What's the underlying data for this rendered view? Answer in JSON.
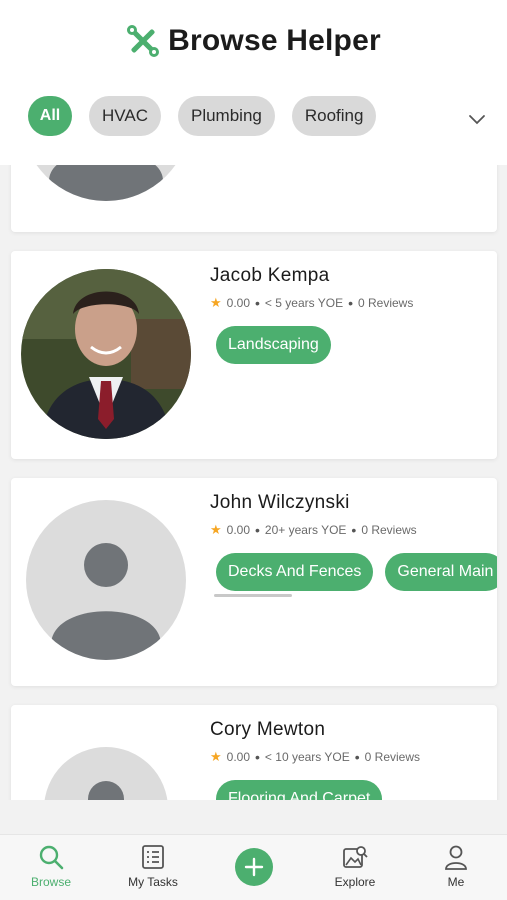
{
  "app": {
    "title": "Browse Helper",
    "logo_icon": "wrench-screwdriver-icon",
    "accent": "#4caf6f"
  },
  "filters": {
    "chips": [
      {
        "label": "All",
        "active": true
      },
      {
        "label": "HVAC"
      },
      {
        "label": "Plumbing"
      },
      {
        "label": "Roofing"
      }
    ],
    "expand_icon": "chevron-down-icon"
  },
  "helpers": [
    {
      "name": "Jacob Kempa",
      "rating": "0.00",
      "experience": "< 5 years YOE",
      "reviews": "0 Reviews",
      "tags": [
        "Landscaping"
      ],
      "avatar": "photo"
    },
    {
      "name": "John Wilczynski",
      "rating": "0.00",
      "experience": "20+ years YOE",
      "reviews": "0 Reviews",
      "tags": [
        "Decks And Fences",
        "General Main"
      ],
      "avatar": "placeholder"
    },
    {
      "name": "Cory Mewton",
      "rating": "0.00",
      "experience": "< 10 years YOE",
      "reviews": "0 Reviews",
      "tags": [
        "Flooring And Carpet"
      ],
      "avatar": "placeholder"
    }
  ],
  "nav": {
    "items": [
      {
        "label": "Browse",
        "icon": "search-icon",
        "active": true
      },
      {
        "label": "My Tasks",
        "icon": "task-list-icon"
      },
      {
        "label": "Explore",
        "icon": "explore-image-icon"
      },
      {
        "label": "Me",
        "icon": "person-icon"
      }
    ],
    "add_icon": "plus-icon"
  }
}
